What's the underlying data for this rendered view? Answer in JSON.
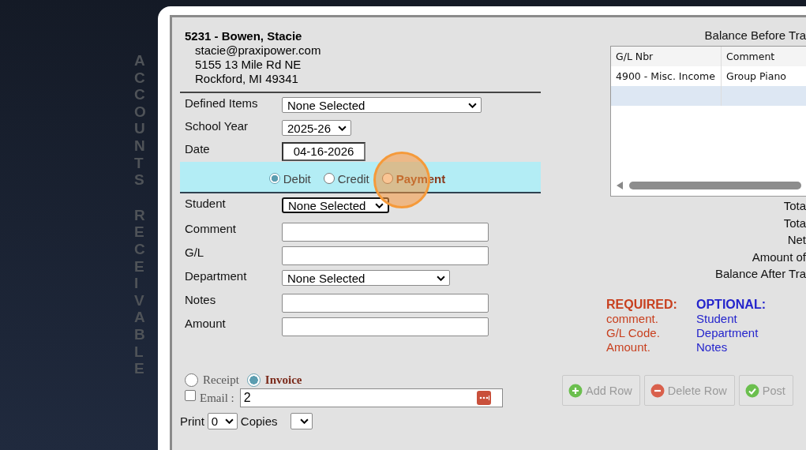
{
  "side_title": [
    "ACCOUNTS",
    "RECEIVABLE"
  ],
  "customer": {
    "heading": "5231 - Bowen, Stacie",
    "lines": [
      "stacie@praxipower.com",
      "5155 13 Mile Rd NE",
      "Rockford, MI 49341"
    ]
  },
  "top_fields": [
    {
      "label": "Defined Items",
      "kind": "select",
      "value": "None Selected"
    },
    {
      "label": "School Year",
      "kind": "select",
      "value": "2025-26"
    },
    {
      "label": "Date",
      "kind": "date",
      "value": "04-16-2026"
    }
  ],
  "transaction_types": [
    {
      "label": "Debit",
      "selected": true,
      "highlighted": false
    },
    {
      "label": "Credit",
      "selected": false,
      "highlighted": false
    },
    {
      "label": "Payment",
      "selected": false,
      "highlighted": true
    }
  ],
  "detail_fields": [
    {
      "label": "Student",
      "kind": "select",
      "value": "None Selected",
      "focused": true
    },
    {
      "label": "Comment",
      "kind": "input",
      "focused": false
    },
    {
      "label": "G/L",
      "kind": "input",
      "focused": false
    },
    {
      "label": "Department",
      "kind": "select",
      "value": "None Selected",
      "focused": false
    },
    {
      "label": "Notes",
      "kind": "input",
      "focused": false
    },
    {
      "label": "Amount",
      "kind": "input",
      "focused": false
    }
  ],
  "output_types": [
    {
      "label": "Receipt",
      "selected": false
    },
    {
      "label": "Invoice",
      "selected": true
    }
  ],
  "email": {
    "label": "Email :",
    "checked": false,
    "value": "2"
  },
  "print": {
    "label": "Print",
    "copies_value": "0",
    "copies_label": "Copies"
  },
  "balance_before": "Balance Before Tra",
  "table": {
    "columns": [
      "G/L Nbr",
      "Comment"
    ],
    "rows": [
      {
        "cells": [
          "4900 - Misc. Income",
          "Group Piano"
        ],
        "selected": false
      },
      {
        "cells": [
          "",
          ""
        ],
        "selected": true
      }
    ]
  },
  "summary": [
    "Tota",
    "Tota",
    "Net",
    "Amount of",
    "Balance After Tra"
  ],
  "required": {
    "title": "REQUIRED:",
    "items": [
      "comment.",
      "G/L Code.",
      "Amount."
    ]
  },
  "optional": {
    "title": "OPTIONAL:",
    "items": [
      "Student",
      "Department",
      "Notes"
    ]
  },
  "buttons": [
    {
      "label": "Add Row",
      "kind": "add",
      "disabled": true
    },
    {
      "label": "Delete Row",
      "kind": "delete",
      "disabled": true
    },
    {
      "label": "Post",
      "kind": "post",
      "disabled": true
    }
  ]
}
